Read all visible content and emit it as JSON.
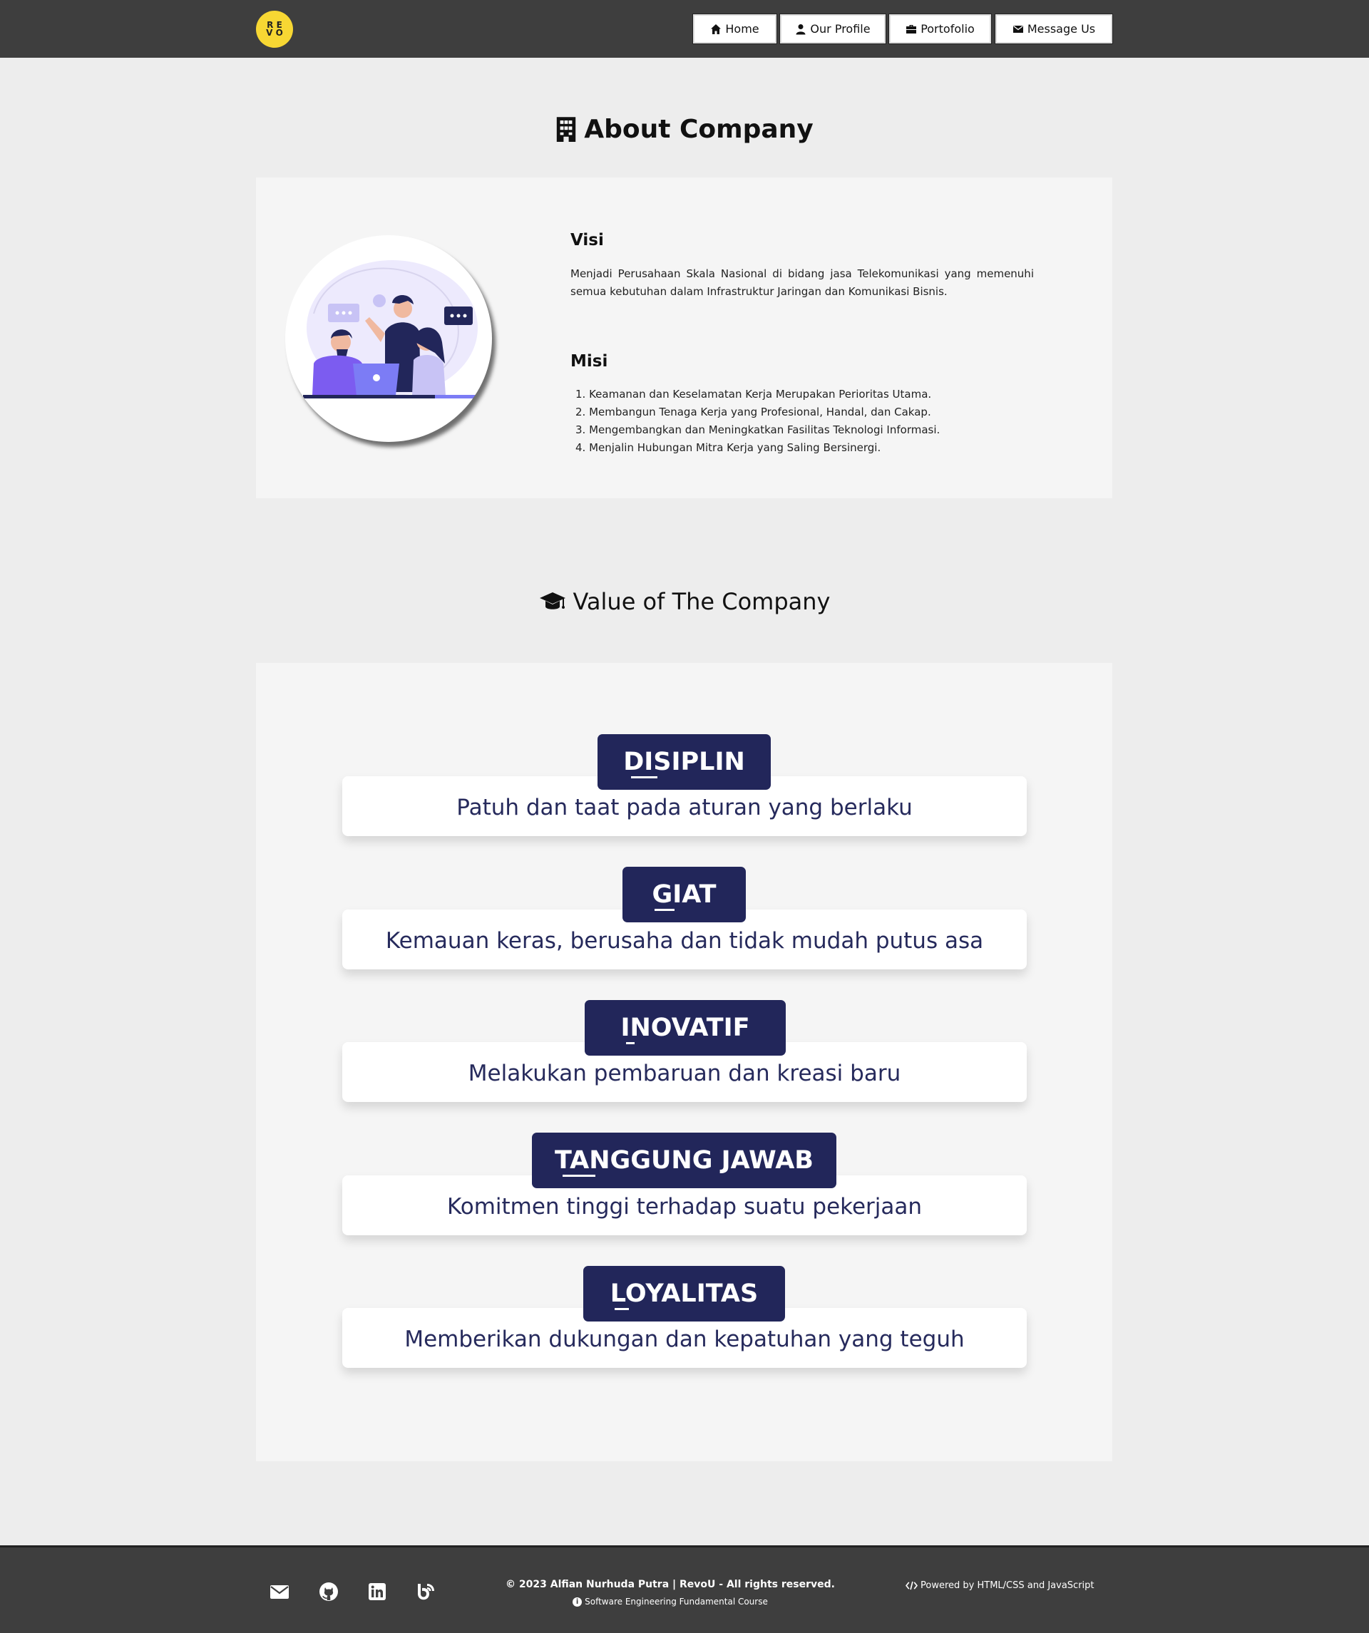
{
  "navbar": {
    "logo_text": "R E\nV O",
    "items": [
      {
        "label": "Home",
        "icon": "home-icon"
      },
      {
        "label": "Our Profile",
        "icon": "user-icon"
      },
      {
        "label": "Portofolio",
        "icon": "briefcase-icon"
      },
      {
        "label": "Message Us",
        "icon": "envelope-icon"
      }
    ]
  },
  "about": {
    "title": "About Company",
    "visi_title": "Visi",
    "visi_text": "Menjadi Perusahaan Skala Nasional di bidang jasa Telekomunikasi yang memenuhi semua kebutuhan dalam Infrastruktur Jaringan dan Komunikasi Bisnis.",
    "misi_title": "Misi",
    "misi": [
      "1. Keamanan dan Keselamatan Kerja Merupakan Perioritas Utama.",
      "2. Membangun Tenaga Kerja yang Profesional, Handal, dan Cakap.",
      "3. Mengembangkan dan Meningkatkan Fasilitas Teknologi Informasi.",
      "4. Menjalin Hubungan Mitra Kerja yang Saling Bersinergi."
    ]
  },
  "values": {
    "title": "Value of The Company",
    "items": [
      {
        "name": "DISIPLIN",
        "desc": "Patuh dan taat pada aturan yang berlaku"
      },
      {
        "name": "GIAT",
        "desc": "Kemauan keras, berusaha dan tidak mudah putus asa"
      },
      {
        "name": "INOVATIF",
        "desc": "Melakukan pembaruan dan kreasi baru"
      },
      {
        "name": "TANGGUNG JAWAB",
        "desc": "Komitmen tinggi terhadap suatu pekerjaan"
      },
      {
        "name": "LOYALITAS",
        "desc": "Memberikan dukungan dan kepatuhan yang teguh"
      }
    ]
  },
  "footer": {
    "social_icons": [
      "envelope-icon",
      "github-icon",
      "linkedin-icon",
      "blog-icon"
    ],
    "copyright": "© 2023 Alfian Nurhuda Putra | RevoU - All rights reserved.",
    "course": "Software Engineering Fundamental Course",
    "powered": "Powered by HTML/CSS and JavaScript"
  },
  "colors": {
    "navbar_bg": "#3e3e3e",
    "logo_yellow": "#f7d733",
    "value_tag_bg": "#22265a",
    "value_text": "#262a5c",
    "page_bg": "#ededed",
    "card_bg": "#f5f5f5"
  }
}
